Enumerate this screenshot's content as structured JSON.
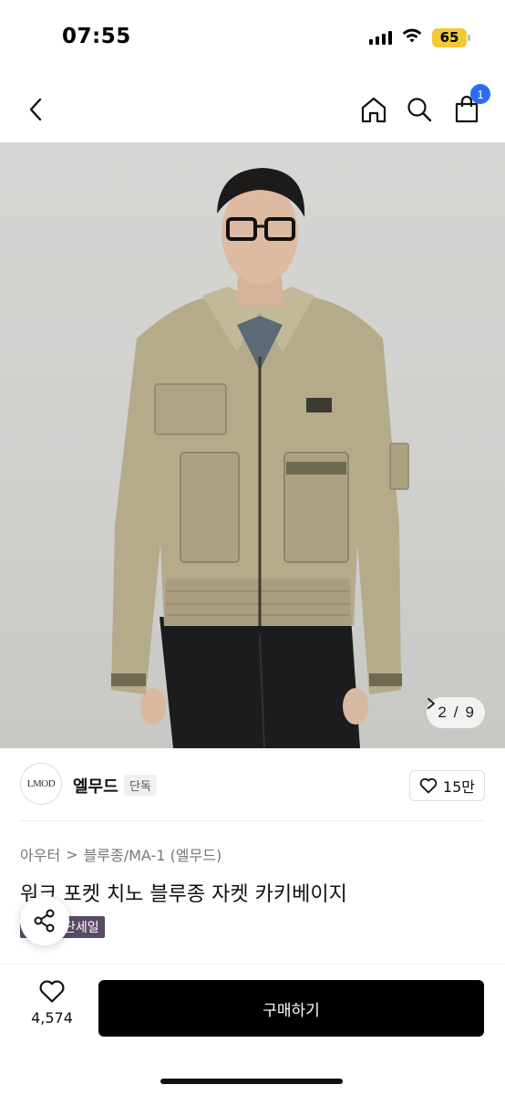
{
  "status_bar": {
    "time": "07:55",
    "battery": "65",
    "icons": [
      "signal-icon",
      "wifi-icon",
      "battery-icon"
    ]
  },
  "nav": {
    "back_icon": "chevron-left-icon",
    "home_icon": "home-icon",
    "search_icon": "search-icon",
    "cart_icon": "cart-icon",
    "cart_badge": "1"
  },
  "gallery": {
    "counter_current": "2",
    "counter_separator": "/",
    "counter_total": "9",
    "counter_icon": "chevron-right-icon"
  },
  "brand": {
    "logo_text": "LMOD",
    "name": "엘무드",
    "tag": "단독",
    "like_count": "15만"
  },
  "product": {
    "category_1": "아우터",
    "category_separator": ">",
    "category_2": "블루종/MA-1 (엘무드)",
    "title": "워크 포켓 치노 블루종 자켓 카키베이지",
    "sale_badge": "단세일"
  },
  "bottom_bar": {
    "wish_count": "4,574",
    "buy_label": "구매하기"
  },
  "colors": {
    "accent_blue": "#2f6bf2",
    "sale_badge": "#5b4a66",
    "battery": "#f2c935",
    "buy_button": "#000000"
  }
}
